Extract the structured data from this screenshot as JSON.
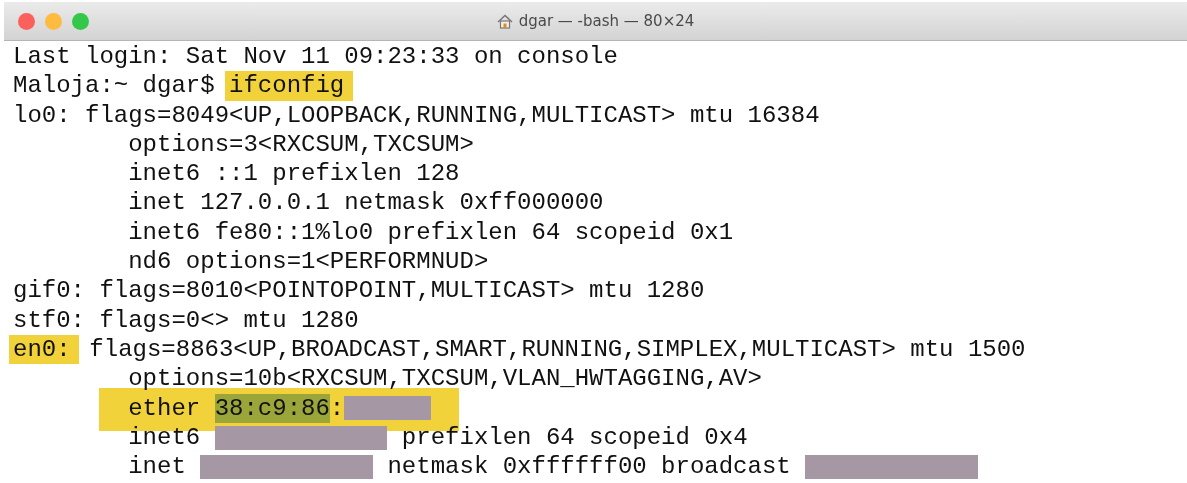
{
  "window": {
    "title": "dgar — -bash — 80×24"
  },
  "lines": [
    {
      "highlighted": false,
      "segments": [
        {
          "kind": "text",
          "text": "Last login: Sat Nov 11 09:23:33 on console"
        }
      ]
    },
    {
      "highlighted": false,
      "segments": [
        {
          "kind": "text",
          "text": "Maloja:~ dgar$ "
        },
        {
          "kind": "highlight",
          "text": "ifconfig"
        }
      ]
    },
    {
      "highlighted": false,
      "segments": [
        {
          "kind": "text",
          "text": "lo0: flags=8049<UP,LOOPBACK,RUNNING,MULTICAST> mtu 16384"
        }
      ],
      "children": [
        {
          "highlighted": false,
          "segments": [
            {
              "kind": "text",
              "text": "options=3<RXCSUM,TXCSUM>"
            }
          ]
        },
        {
          "highlighted": false,
          "segments": [
            {
              "kind": "text",
              "text": "inet6 ::1 prefixlen 128"
            }
          ]
        },
        {
          "highlighted": false,
          "segments": [
            {
              "kind": "text",
              "text": "inet 127.0.0.1 netmask 0xff000000"
            }
          ]
        },
        {
          "highlighted": false,
          "segments": [
            {
              "kind": "text",
              "text": "inet6 fe80::1%lo0 prefixlen 64 scopeid 0x1"
            }
          ]
        },
        {
          "highlighted": false,
          "segments": [
            {
              "kind": "text",
              "text": "nd6 options=1<PERFORMNUD>"
            }
          ]
        }
      ]
    },
    {
      "highlighted": false,
      "segments": [
        {
          "kind": "text",
          "text": "gif0: flags=8010<POINTOPOINT,MULTICAST> mtu 1280"
        }
      ]
    },
    {
      "highlighted": false,
      "segments": [
        {
          "kind": "text",
          "text": "stf0: flags=0<> mtu 1280"
        }
      ]
    },
    {
      "highlighted": false,
      "segments": [
        {
          "kind": "highlight",
          "text": "en0:"
        },
        {
          "kind": "text",
          "text": " flags=8863<UP,BROADCAST,SMART,RUNNING,SIMPLEX,MULTICAST> mtu 1500"
        }
      ],
      "children": [
        {
          "highlighted": false,
          "segments": [
            {
              "kind": "text",
              "text": "options=10b<RXCSUM,TXCSUM,VLAN_HWTAGGING,AV>"
            }
          ]
        },
        {
          "highlighted": true,
          "segments": [
            {
              "kind": "text",
              "text": "ether "
            },
            {
              "kind": "mark",
              "text": "38:c9:86"
            },
            {
              "kind": "text",
              "text": ":"
            },
            {
              "kind": "redacted"
            }
          ]
        },
        {
          "highlighted": false,
          "segments": [
            {
              "kind": "text",
              "text": "inet6 "
            },
            {
              "kind": "redacted"
            },
            {
              "kind": "text",
              "text": " prefixlen 64 scopeid 0x4"
            }
          ]
        },
        {
          "highlighted": false,
          "segments": [
            {
              "kind": "text",
              "text": "inet "
            },
            {
              "kind": "redacted"
            },
            {
              "kind": "text",
              "text": " netmask 0xffffff00 broadcast "
            },
            {
              "kind": "redacted"
            }
          ]
        }
      ]
    }
  ]
}
